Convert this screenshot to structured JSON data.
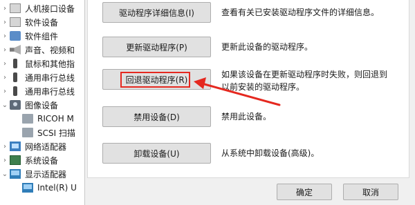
{
  "tree": {
    "items": [
      {
        "label": "人机接口设备",
        "expanded": false,
        "icon": "hid-icon"
      },
      {
        "label": "软件设备",
        "expanded": false,
        "icon": "software-device-icon"
      },
      {
        "label": "软件组件",
        "expanded": false,
        "icon": "software-component-icon"
      },
      {
        "label": "声音、视频和",
        "expanded": false,
        "icon": "speaker-icon"
      },
      {
        "label": "鼠标和其他指",
        "expanded": false,
        "icon": "mouse-icon"
      },
      {
        "label": "通用串行总线",
        "expanded": false,
        "icon": "usb-icon"
      },
      {
        "label": "通用串行总线",
        "expanded": false,
        "icon": "usb-icon"
      },
      {
        "label": "图像设备",
        "expanded": true,
        "icon": "camera-icon"
      },
      {
        "label": "RICOH M",
        "child": true,
        "icon": "printer-icon"
      },
      {
        "label": "SCSI 扫描",
        "child": true,
        "icon": "scanner-icon"
      },
      {
        "label": "网络适配器",
        "expanded": false,
        "icon": "network-adapter-icon"
      },
      {
        "label": "系统设备",
        "expanded": false,
        "icon": "system-device-icon"
      },
      {
        "label": "显示适配器",
        "expanded": true,
        "icon": "display-adapter-icon"
      },
      {
        "label": "Intel(R) U",
        "child": true,
        "icon": "display-adapter-icon"
      }
    ]
  },
  "driver_actions": [
    {
      "button": "驱动程序详细信息(I)",
      "desc1": "查看有关已安装驱动程序文件的详细信息。",
      "desc2": ""
    },
    {
      "button": "更新驱动程序(P)",
      "desc1": "更新此设备的驱动程序。",
      "desc2": ""
    },
    {
      "button": "回退驱动程序(R)",
      "desc1": "如果该设备在更新驱动程序时失败，则回退到",
      "desc2": "以前安装的驱动程序。"
    },
    {
      "button": "禁用设备(D)",
      "desc1": "禁用此设备。",
      "desc2": ""
    },
    {
      "button": "卸载设备(U)",
      "desc1": "从系统中卸载设备(高级)。",
      "desc2": ""
    }
  ],
  "footer": {
    "ok_label": "确定",
    "cancel_label": "取消"
  },
  "colors": {
    "annotation": "#e5281f",
    "button_face": "#e1e1e1",
    "dialog_bg": "#f0f0f0"
  }
}
